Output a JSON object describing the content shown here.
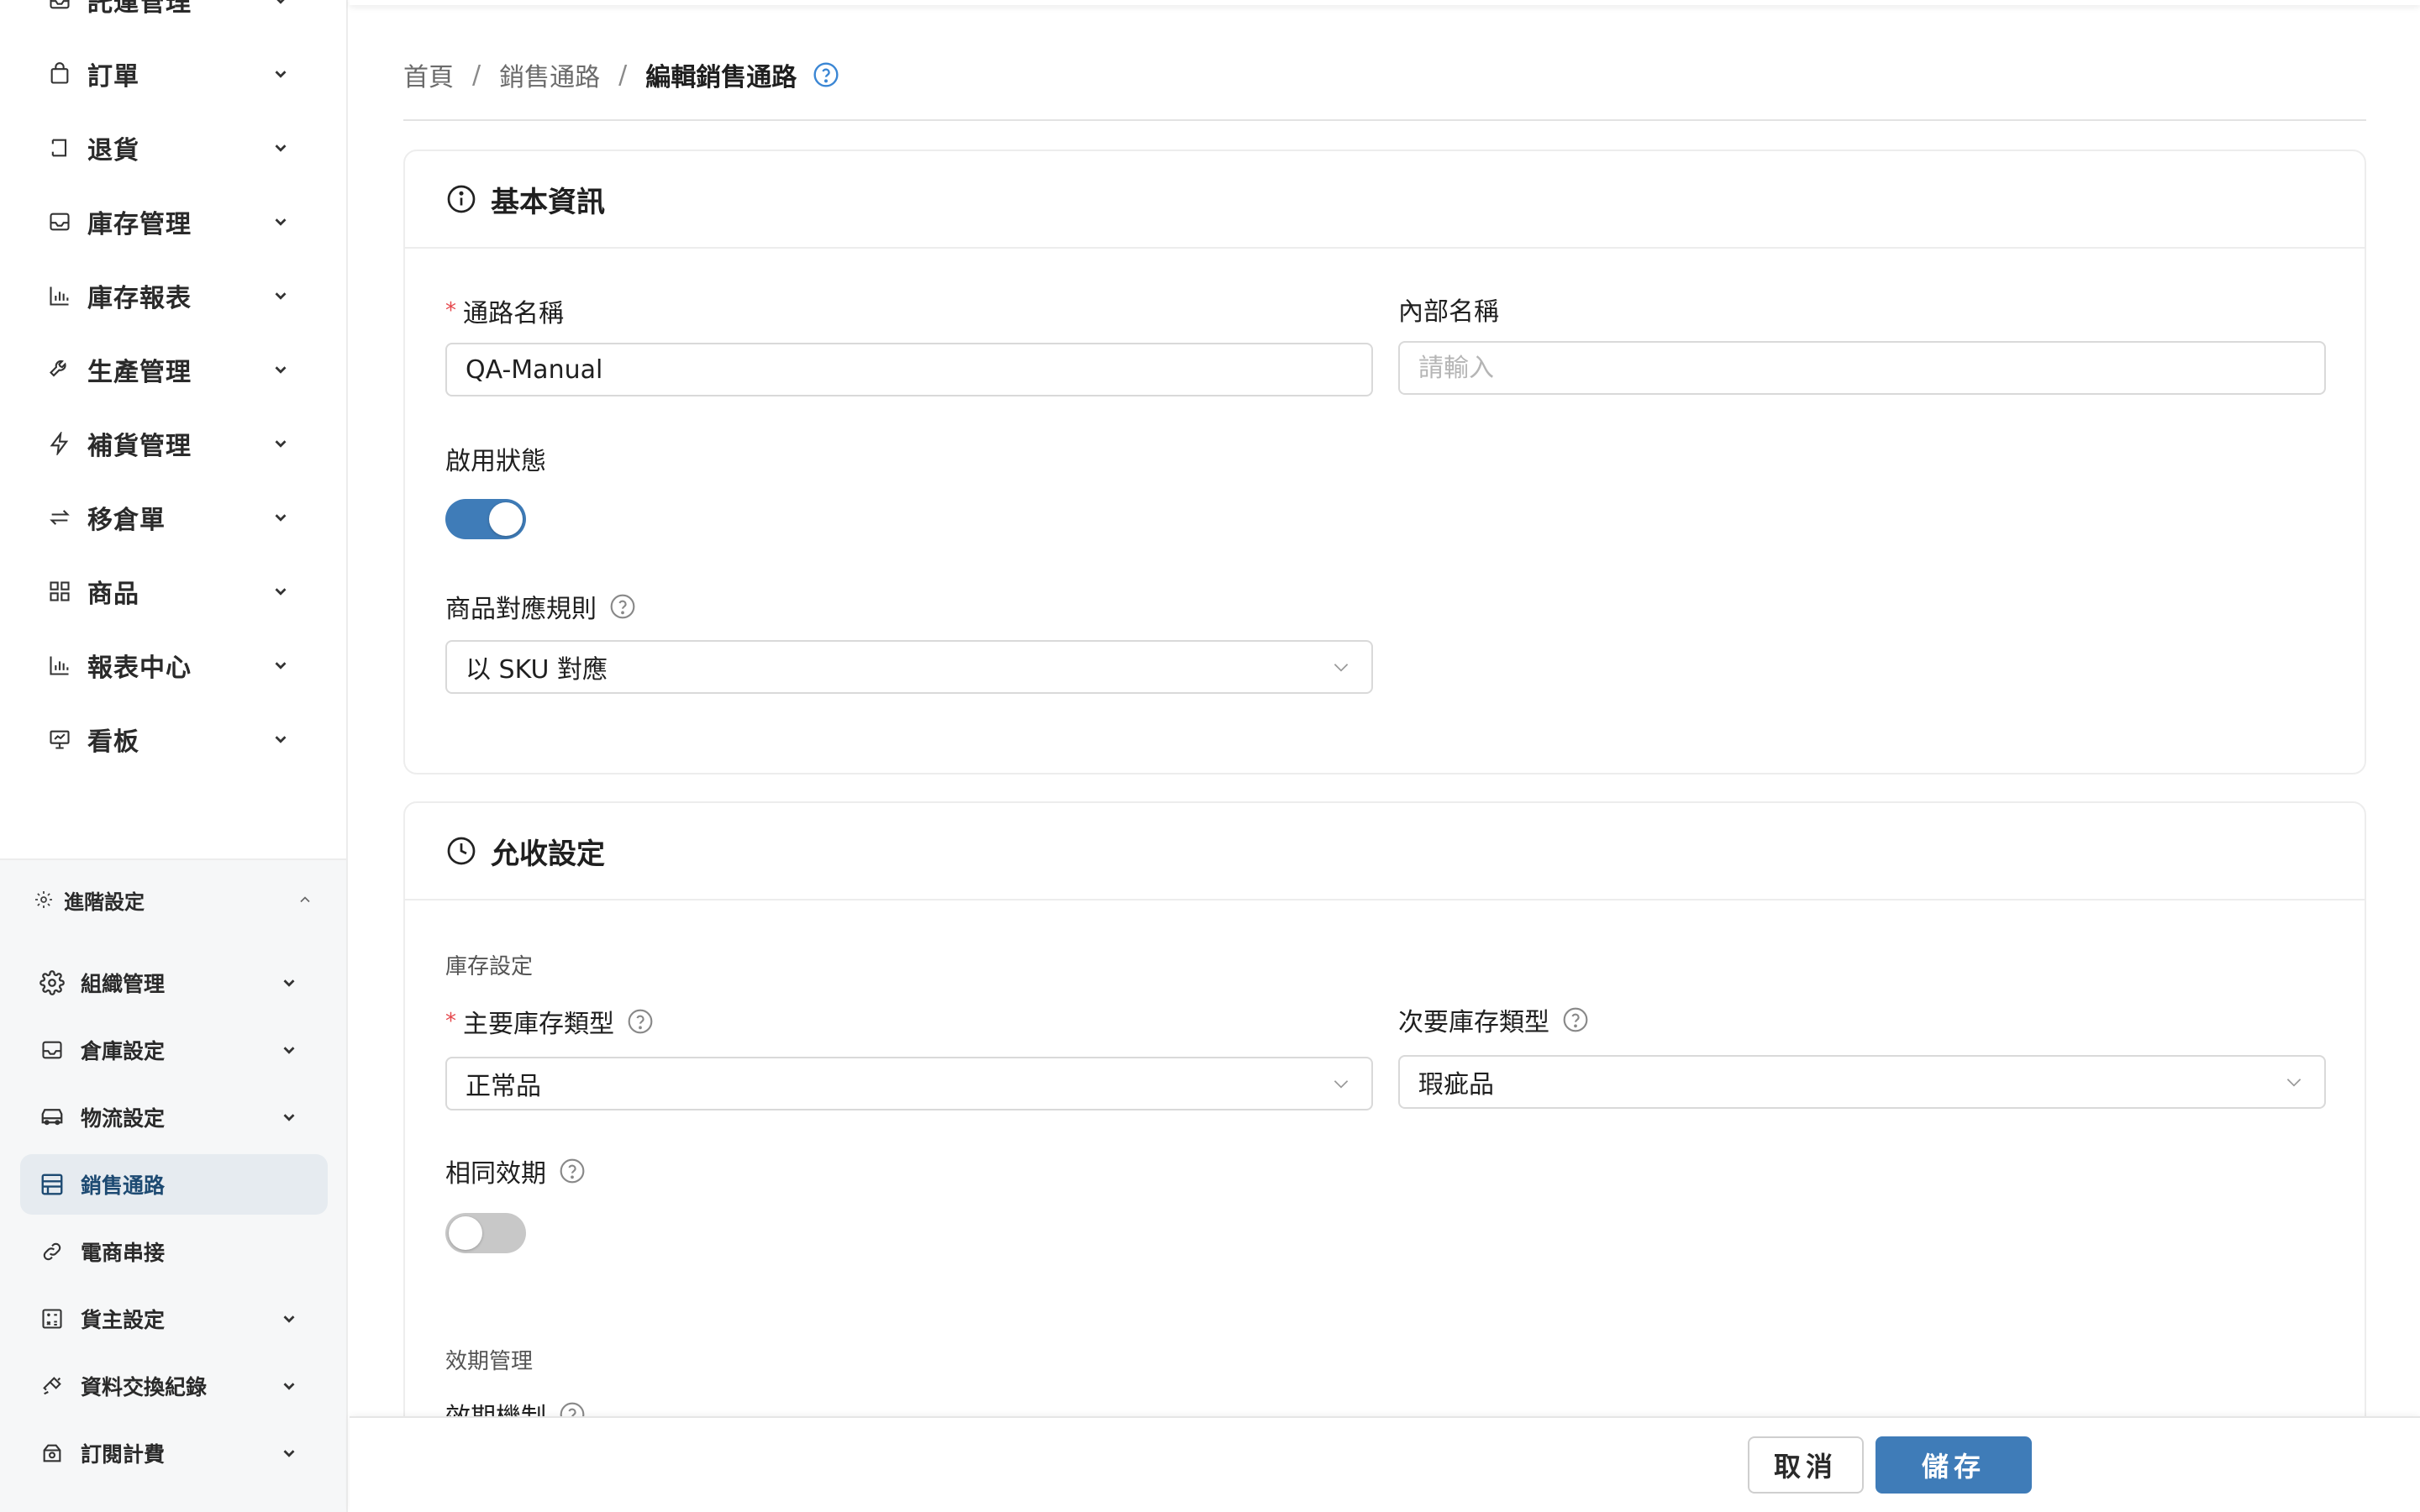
{
  "sidebar": {
    "top_item_partial": "託運管理",
    "items": [
      {
        "label": "訂單",
        "icon": "shopping-bag-icon"
      },
      {
        "label": "退貨",
        "icon": "return-icon"
      },
      {
        "label": "庫存管理",
        "icon": "inbox-icon"
      },
      {
        "label": "庫存報表",
        "icon": "bar-chart-icon"
      },
      {
        "label": "生產管理",
        "icon": "wrench-icon"
      },
      {
        "label": "補貨管理",
        "icon": "lightning-icon"
      },
      {
        "label": "移倉單",
        "icon": "swap-icon"
      },
      {
        "label": "商品",
        "icon": "grid-icon"
      },
      {
        "label": "報表中心",
        "icon": "bar-chart-icon"
      },
      {
        "label": "看板",
        "icon": "presentation-icon"
      }
    ],
    "advanced": {
      "label": "進階設定",
      "items": [
        {
          "label": "組織管理",
          "icon": "gear-icon",
          "has_children": true
        },
        {
          "label": "倉庫設定",
          "icon": "inbox-icon",
          "has_children": true
        },
        {
          "label": "物流設定",
          "icon": "truck-icon",
          "has_children": true
        },
        {
          "label": "銷售通路",
          "icon": "shop-icon",
          "has_children": false,
          "active": true
        },
        {
          "label": "電商串接",
          "icon": "link-icon",
          "has_children": false
        },
        {
          "label": "貨主設定",
          "icon": "calculator-icon",
          "has_children": true
        },
        {
          "label": "資料交換紀錄",
          "icon": "api-icon",
          "has_children": true
        },
        {
          "label": "訂閱計費",
          "icon": "subscription-icon",
          "has_children": true
        }
      ]
    }
  },
  "breadcrumb": {
    "home": "首頁",
    "parent": "銷售通路",
    "current": "編輯銷售通路",
    "separator": "/"
  },
  "basic_info": {
    "title": "基本資訊",
    "channel_name_label": "通路名稱",
    "channel_name_value": "QA-Manual",
    "internal_name_label": "內部名稱",
    "internal_name_placeholder": "請輸入",
    "enabled_label": "啟用狀態",
    "enabled": true,
    "mapping_rule_label": "商品對應規則",
    "mapping_rule_value": "以 SKU 對應"
  },
  "acceptance": {
    "title": "允收設定",
    "stock_section_label": "庫存設定",
    "primary_stock_label": "主要庫存類型",
    "primary_stock_value": "正常品",
    "secondary_stock_label": "次要庫存類型",
    "secondary_stock_value": "瑕疵品",
    "same_expiry_label": "相同效期",
    "same_expiry": false,
    "expiry_section_label": "效期管理",
    "expiry_mechanism_label": "效期機制"
  },
  "footer": {
    "cancel_label": "取消",
    "save_label": "儲存"
  },
  "colors": {
    "accent": "#3f7cb8",
    "active_bg": "#e6ebf0",
    "required": "#e5484d"
  }
}
